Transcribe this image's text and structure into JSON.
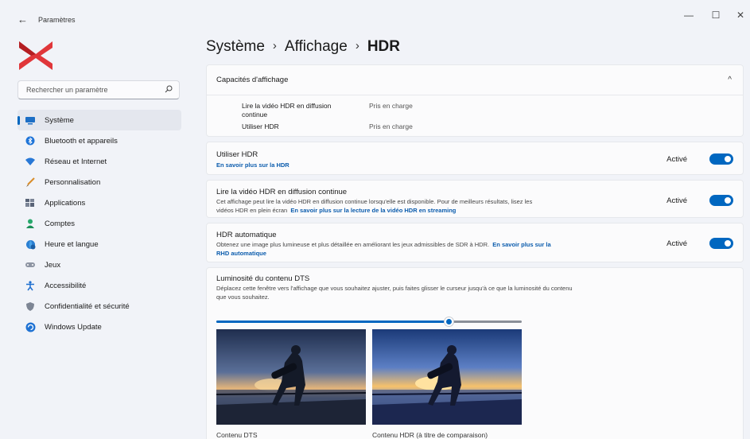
{
  "window": {
    "back_glyph": "←",
    "title": "Paramètres",
    "minimize_glyph": "—",
    "maximize_glyph": "☐",
    "close_glyph": "✕"
  },
  "search": {
    "placeholder": "Rechercher un paramètre"
  },
  "sidebar": {
    "items": [
      {
        "label": "Système",
        "icon": "monitor-icon",
        "selected": true
      },
      {
        "label": "Bluetooth et appareils",
        "icon": "bluetooth-icon"
      },
      {
        "label": "Réseau et Internet",
        "icon": "wifi-icon"
      },
      {
        "label": "Personnalisation",
        "icon": "brush-icon"
      },
      {
        "label": "Applications",
        "icon": "apps-icon"
      },
      {
        "label": "Comptes",
        "icon": "user-icon"
      },
      {
        "label": "Heure et langue",
        "icon": "globe-clock-icon"
      },
      {
        "label": "Jeux",
        "icon": "gamepad-icon"
      },
      {
        "label": "Accessibilité",
        "icon": "accessibility-icon"
      },
      {
        "label": "Confidentialité et sécurité",
        "icon": "shield-icon"
      },
      {
        "label": "Windows Update",
        "icon": "update-icon"
      }
    ]
  },
  "breadcrumb": {
    "part1": "Système",
    "sep": "›",
    "part2": "Affichage",
    "current": "HDR"
  },
  "capabilities": {
    "title": "Capacités d'affichage",
    "chevron": "^",
    "row1_label_line1": "Lire la vidéo HDR en diffusion",
    "row1_label_line2": "continue",
    "row1_value": "Pris en charge",
    "row2_label": "Utiliser HDR",
    "row2_value": "Pris en charge"
  },
  "use_hdr": {
    "title": "Utiliser HDR",
    "link": "En savoir plus sur la HDR",
    "state": "Activé",
    "on": true
  },
  "stream_hdr": {
    "title": "Lire la vidéo HDR en diffusion continue",
    "desc_line1": "Cet affichage peut lire la vidéo HDR en diffusion continue lorsqu'elle est disponible. Pour de meilleurs résultats, lisez les",
    "desc_line2": "vidéos HDR en plein écran",
    "link": "En savoir plus sur la lecture de la vidéo HDR en streaming",
    "state": "Activé",
    "on": true
  },
  "auto_hdr": {
    "title": "HDR automatique",
    "desc": "Obtenez une image plus lumineuse et plus détaillée en améliorant les jeux admissibles de SDR à HDR.",
    "link1": "En savoir plus sur la",
    "link2": "RHD automatique",
    "state": "Activé",
    "on": true
  },
  "brightness": {
    "title": "Luminosité du contenu DTS",
    "desc_line1": "Déplacez cette fenêtre vers l'affichage que vous souhaitez ajuster, puis faites glisser le curseur jusqu'à ce que la luminosité du contenu",
    "desc_line2": "que vous souhaitez.",
    "slider_fraction": 0.76,
    "caption_left": "Contenu DTS",
    "caption_right": "Contenu HDR (à titre de comparaison)"
  },
  "colors": {
    "accent": "#0067c0",
    "link": "#0b5cad",
    "background": "#f1f3f8"
  }
}
